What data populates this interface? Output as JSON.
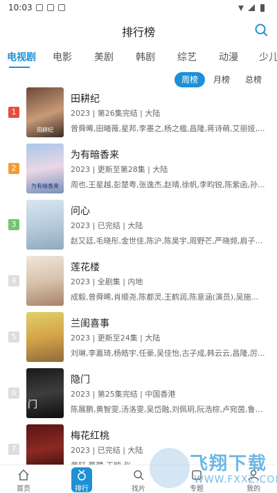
{
  "statusbar": {
    "time": "10:03"
  },
  "header": {
    "title": "排行榜"
  },
  "categories": [
    "电视剧",
    "电影",
    "美剧",
    "韩剧",
    "综艺",
    "动漫",
    "少儿"
  ],
  "period": [
    "周榜",
    "月榜",
    "总榜"
  ],
  "items": [
    {
      "rank": "1",
      "title": "田耕纪",
      "meta": "2023 | 第26集完结 | 大陆",
      "cast": "曾舜晞,田曦薇,星邦,李墨之,杨之楹,昌隆,蒋诗萌,艾丽娅,...",
      "poster_text": "田耕纪"
    },
    {
      "rank": "2",
      "title": "为有暗香来",
      "meta": "2023 | 更新至第28集 | 大陆",
      "cast": "周也,王星越,彭楚粤,张逸杰,赵晴,徐帆,李昀锐,陈紫函,孙...",
      "poster_text": "为有暗香来"
    },
    {
      "rank": "3",
      "title": "问心",
      "meta": "2023 | 已完结 | 大陆",
      "cast": "赵又廷,毛晓彤,金世佳,陈沪,陈昊宇,周野芒,严晓频,肩子斌...",
      "poster_text": ""
    },
    {
      "rank": "4",
      "title": "莲花楼",
      "meta": "2023 | 全剧集 | 内地",
      "cast": "成毅,曾舜晞,肖顺尧,陈都灵,王鹤润,陈意涵(演员),吴施...",
      "poster_text": ""
    },
    {
      "rank": "5",
      "title": "兰闺喜事",
      "meta": "2023 | 更新至24集 | 大陆",
      "cast": "刘琳,李嘉琦,杨皓宇,任豪,吴佳怡,古子成,韩云云,昌隆,厉...",
      "poster_text": ""
    },
    {
      "rank": "6",
      "title": "隐门",
      "meta": "2023 | 第25集完结 | 中国香港",
      "cast": "陈展鹏,黄智雯,汤洛雯,吴岱融,刘佩玥,阮浩棕,卢宛茵,鲁振...",
      "poster_text": "门"
    },
    {
      "rank": "7",
      "title": "梅花红桃",
      "meta": "2023 | 已完结 | 大陆",
      "cast": "黄轩,蔡鹭,王鸥,张...",
      "poster_text": ""
    }
  ],
  "nav": [
    "首页",
    "排行",
    "找片",
    "专题",
    "我的"
  ],
  "watermark": {
    "line1": "飞翔下载",
    "line2": "WWW.FXXZ.COM"
  },
  "colors": {
    "accent": "#1e90d6",
    "rank1": "#e74c3c",
    "rank2": "#f39c34",
    "rank3": "#71c671",
    "rank_other": "#dddddd"
  }
}
